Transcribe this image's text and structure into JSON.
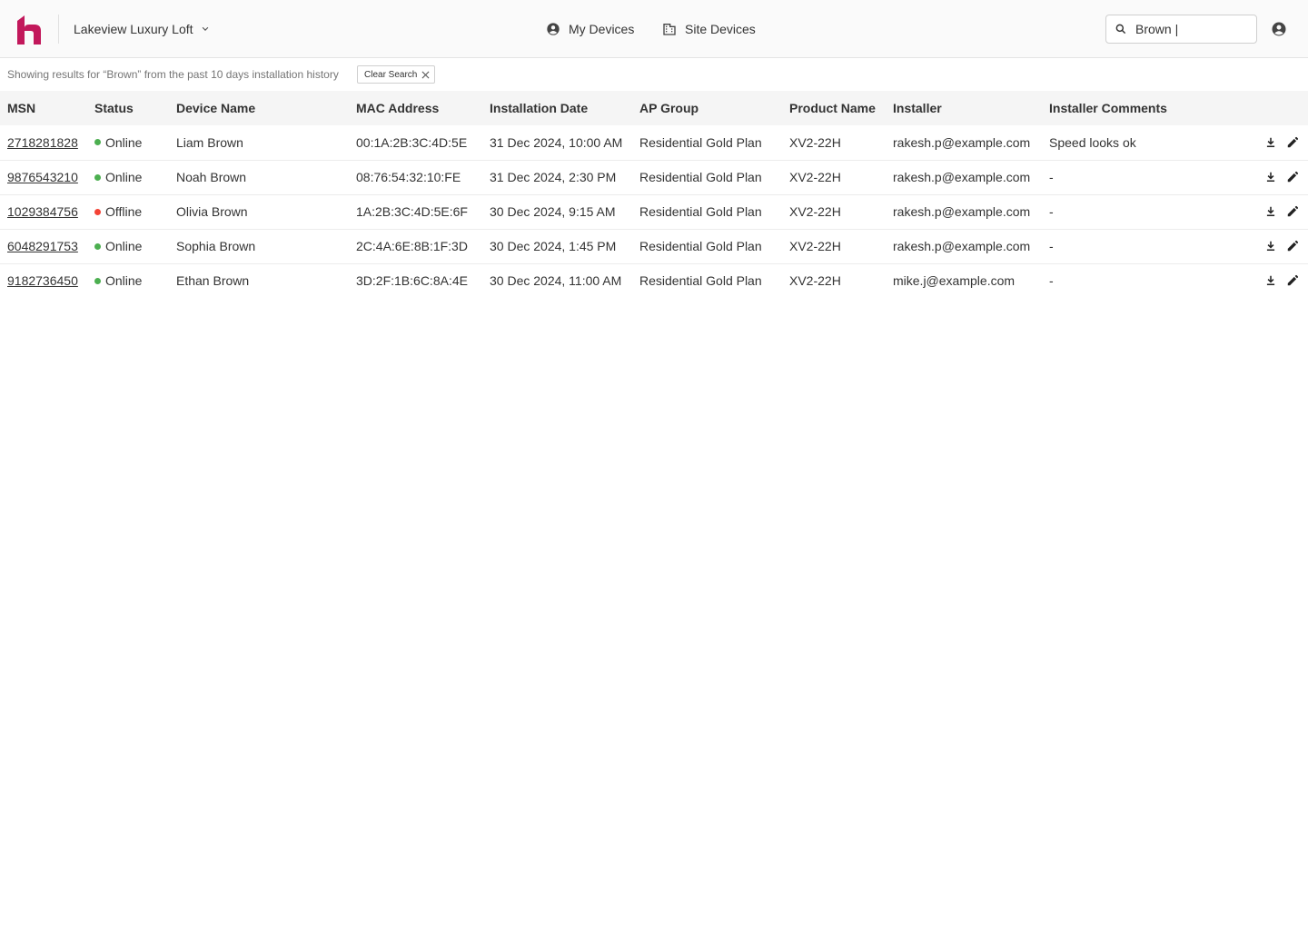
{
  "app": {
    "site_name": "Lakeview Luxury Loft",
    "brand_color": "#c2185b"
  },
  "nav": {
    "my_devices": "My Devices",
    "site_devices": "Site Devices"
  },
  "search": {
    "value": "Brown |",
    "icon": "search-icon"
  },
  "results": {
    "summary": "Showing results for “Brown” from the past 10 days installation history",
    "clear_label": "Clear Search"
  },
  "table": {
    "columns": [
      "MSN",
      "Status",
      "Device Name",
      "MAC Address",
      "Installation Date",
      "AP Group",
      "Product Name",
      "Installer",
      "Installer Comments"
    ],
    "status_colors": {
      "Online": "#4caf50",
      "Offline": "#f44336"
    },
    "rows": [
      {
        "msn": "2718281828",
        "status": "Online",
        "device_name": "Liam Brown",
        "mac": "00:1A:2B:3C:4D:5E",
        "install_date": "31 Dec 2024, 10:00 AM",
        "ap_group": "Residential Gold Plan",
        "product": "XV2-22H",
        "installer": "rakesh.p@example.com",
        "comments": "Speed looks ok"
      },
      {
        "msn": "9876543210",
        "status": "Online",
        "device_name": "Noah Brown",
        "mac": "08:76:54:32:10:FE",
        "install_date": "31 Dec 2024, 2:30 PM",
        "ap_group": "Residential Gold Plan",
        "product": "XV2-22H",
        "installer": "rakesh.p@example.com",
        "comments": "-"
      },
      {
        "msn": "1029384756",
        "status": "Offline",
        "device_name": "Olivia Brown",
        "mac": "1A:2B:3C:4D:5E:6F",
        "install_date": "30 Dec 2024, 9:15 AM",
        "ap_group": "Residential Gold Plan",
        "product": "XV2-22H",
        "installer": "rakesh.p@example.com",
        "comments": "-"
      },
      {
        "msn": "6048291753",
        "status": "Online",
        "device_name": "Sophia Brown",
        "mac": "2C:4A:6E:8B:1F:3D",
        "install_date": "30 Dec 2024, 1:45 PM",
        "ap_group": "Residential Gold Plan",
        "product": "XV2-22H",
        "installer": "rakesh.p@example.com",
        "comments": "-"
      },
      {
        "msn": "9182736450",
        "status": "Online",
        "device_name": "Ethan Brown",
        "mac": "3D:2F:1B:6C:8A:4E",
        "install_date": "30 Dec 2024, 11:00 AM",
        "ap_group": "Residential Gold Plan",
        "product": "XV2-22H",
        "installer": "mike.j@example.com",
        "comments": "-"
      }
    ]
  }
}
